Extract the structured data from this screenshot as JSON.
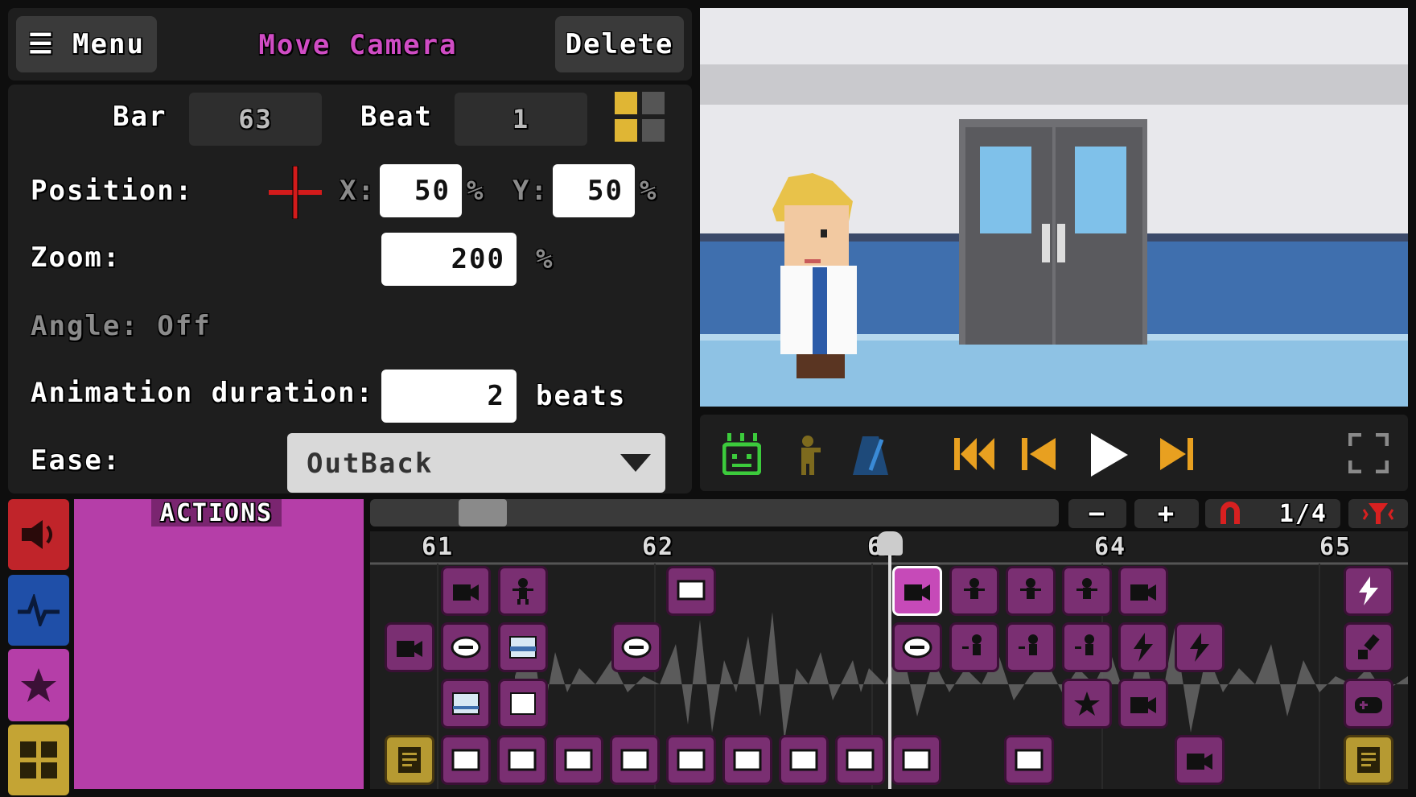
{
  "toolbar": {
    "menu_label": "☰ Menu",
    "title": "Move Camera",
    "delete_label": "Delete"
  },
  "props": {
    "bar_label": "Bar",
    "bar_value": "63",
    "beat_label": "Beat",
    "beat_value": "1",
    "position_label": "Position:",
    "x_label": "X:",
    "x_value": "50",
    "x_unit": "%",
    "y_label": "Y:",
    "y_value": "50",
    "y_unit": "%",
    "zoom_label": "Zoom:",
    "zoom_value": "200",
    "zoom_unit": "%",
    "angle_label": "Angle: Off",
    "anim_label": "Animation duration:",
    "anim_value": "2",
    "anim_unit": "beats",
    "ease_label": "Ease:",
    "ease_value": "OutBack"
  },
  "tabs": {
    "actions_label": "ACTIONS"
  },
  "timeline": {
    "zoom_out": "−",
    "zoom_in": "+",
    "snap": "1/4",
    "bars": [
      "61",
      "62",
      "63",
      "64",
      "65"
    ],
    "playhead_bar": "63"
  },
  "colors": {
    "accent": "#d04cc4",
    "block": "#7a2f72",
    "panel": "#1e1e1e"
  }
}
